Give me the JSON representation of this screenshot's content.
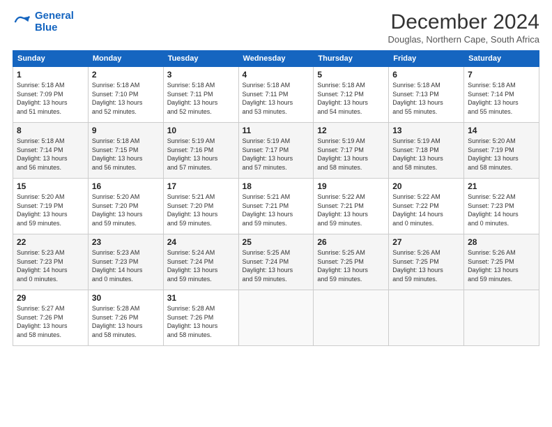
{
  "header": {
    "logo_line1": "General",
    "logo_line2": "Blue",
    "month_title": "December 2024",
    "subtitle": "Douglas, Northern Cape, South Africa"
  },
  "weekdays": [
    "Sunday",
    "Monday",
    "Tuesday",
    "Wednesday",
    "Thursday",
    "Friday",
    "Saturday"
  ],
  "weeks": [
    [
      {
        "day": "1",
        "info": "Sunrise: 5:18 AM\nSunset: 7:09 PM\nDaylight: 13 hours\nand 51 minutes."
      },
      {
        "day": "2",
        "info": "Sunrise: 5:18 AM\nSunset: 7:10 PM\nDaylight: 13 hours\nand 52 minutes."
      },
      {
        "day": "3",
        "info": "Sunrise: 5:18 AM\nSunset: 7:11 PM\nDaylight: 13 hours\nand 52 minutes."
      },
      {
        "day": "4",
        "info": "Sunrise: 5:18 AM\nSunset: 7:11 PM\nDaylight: 13 hours\nand 53 minutes."
      },
      {
        "day": "5",
        "info": "Sunrise: 5:18 AM\nSunset: 7:12 PM\nDaylight: 13 hours\nand 54 minutes."
      },
      {
        "day": "6",
        "info": "Sunrise: 5:18 AM\nSunset: 7:13 PM\nDaylight: 13 hours\nand 55 minutes."
      },
      {
        "day": "7",
        "info": "Sunrise: 5:18 AM\nSunset: 7:14 PM\nDaylight: 13 hours\nand 55 minutes."
      }
    ],
    [
      {
        "day": "8",
        "info": "Sunrise: 5:18 AM\nSunset: 7:14 PM\nDaylight: 13 hours\nand 56 minutes."
      },
      {
        "day": "9",
        "info": "Sunrise: 5:18 AM\nSunset: 7:15 PM\nDaylight: 13 hours\nand 56 minutes."
      },
      {
        "day": "10",
        "info": "Sunrise: 5:19 AM\nSunset: 7:16 PM\nDaylight: 13 hours\nand 57 minutes."
      },
      {
        "day": "11",
        "info": "Sunrise: 5:19 AM\nSunset: 7:17 PM\nDaylight: 13 hours\nand 57 minutes."
      },
      {
        "day": "12",
        "info": "Sunrise: 5:19 AM\nSunset: 7:17 PM\nDaylight: 13 hours\nand 58 minutes."
      },
      {
        "day": "13",
        "info": "Sunrise: 5:19 AM\nSunset: 7:18 PM\nDaylight: 13 hours\nand 58 minutes."
      },
      {
        "day": "14",
        "info": "Sunrise: 5:20 AM\nSunset: 7:19 PM\nDaylight: 13 hours\nand 58 minutes."
      }
    ],
    [
      {
        "day": "15",
        "info": "Sunrise: 5:20 AM\nSunset: 7:19 PM\nDaylight: 13 hours\nand 59 minutes."
      },
      {
        "day": "16",
        "info": "Sunrise: 5:20 AM\nSunset: 7:20 PM\nDaylight: 13 hours\nand 59 minutes."
      },
      {
        "day": "17",
        "info": "Sunrise: 5:21 AM\nSunset: 7:20 PM\nDaylight: 13 hours\nand 59 minutes."
      },
      {
        "day": "18",
        "info": "Sunrise: 5:21 AM\nSunset: 7:21 PM\nDaylight: 13 hours\nand 59 minutes."
      },
      {
        "day": "19",
        "info": "Sunrise: 5:22 AM\nSunset: 7:21 PM\nDaylight: 13 hours\nand 59 minutes."
      },
      {
        "day": "20",
        "info": "Sunrise: 5:22 AM\nSunset: 7:22 PM\nDaylight: 14 hours\nand 0 minutes."
      },
      {
        "day": "21",
        "info": "Sunrise: 5:22 AM\nSunset: 7:23 PM\nDaylight: 14 hours\nand 0 minutes."
      }
    ],
    [
      {
        "day": "22",
        "info": "Sunrise: 5:23 AM\nSunset: 7:23 PM\nDaylight: 14 hours\nand 0 minutes."
      },
      {
        "day": "23",
        "info": "Sunrise: 5:23 AM\nSunset: 7:23 PM\nDaylight: 14 hours\nand 0 minutes."
      },
      {
        "day": "24",
        "info": "Sunrise: 5:24 AM\nSunset: 7:24 PM\nDaylight: 13 hours\nand 59 minutes."
      },
      {
        "day": "25",
        "info": "Sunrise: 5:25 AM\nSunset: 7:24 PM\nDaylight: 13 hours\nand 59 minutes."
      },
      {
        "day": "26",
        "info": "Sunrise: 5:25 AM\nSunset: 7:25 PM\nDaylight: 13 hours\nand 59 minutes."
      },
      {
        "day": "27",
        "info": "Sunrise: 5:26 AM\nSunset: 7:25 PM\nDaylight: 13 hours\nand 59 minutes."
      },
      {
        "day": "28",
        "info": "Sunrise: 5:26 AM\nSunset: 7:25 PM\nDaylight: 13 hours\nand 59 minutes."
      }
    ],
    [
      {
        "day": "29",
        "info": "Sunrise: 5:27 AM\nSunset: 7:26 PM\nDaylight: 13 hours\nand 58 minutes."
      },
      {
        "day": "30",
        "info": "Sunrise: 5:28 AM\nSunset: 7:26 PM\nDaylight: 13 hours\nand 58 minutes."
      },
      {
        "day": "31",
        "info": "Sunrise: 5:28 AM\nSunset: 7:26 PM\nDaylight: 13 hours\nand 58 minutes."
      },
      null,
      null,
      null,
      null
    ]
  ]
}
